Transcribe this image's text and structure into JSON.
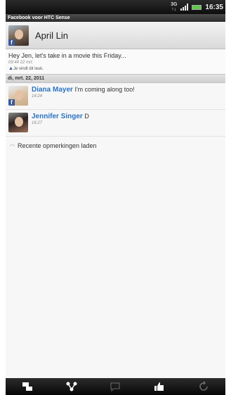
{
  "status_bar": {
    "network_top": "3G",
    "network_bottom": "↑↓",
    "time": "16:35",
    "battery_color": "#5ec94a"
  },
  "app_bar": {
    "title": "Facebook voor HTC Sense"
  },
  "header": {
    "name": "April Lin",
    "avatar_icon": "profile-photo",
    "badge": "f"
  },
  "post": {
    "text": "Hey Jen, let's take in a movie this Friday...",
    "time": "09:44 22 mrt.",
    "like_text": "Je vindt dit leuk.",
    "like_icon": "thumbs-up-icon"
  },
  "date_separator": "di, mrt. 22, 2011",
  "comments": [
    {
      "name": "Diana Mayer",
      "text": "I'm coming along too!",
      "time": "14:24"
    },
    {
      "name": "Jennifer Singer",
      "text": "D",
      "time": "16:27"
    }
  ],
  "loading": {
    "text": "Recente opmerkingen laden"
  },
  "bottom_bar": {
    "buttons": [
      "post-icon",
      "share-icon",
      "comment-icon",
      "like-icon",
      "refresh-icon"
    ],
    "accent_color": "#2b72c2"
  }
}
